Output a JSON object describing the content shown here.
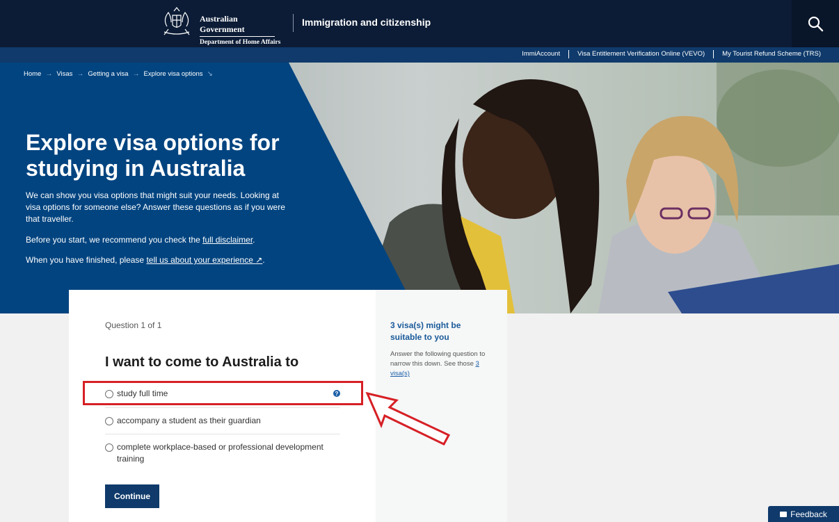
{
  "header": {
    "gov_line1": "Australian Government",
    "gov_line2": "Department of Home Affairs",
    "site_title": "Immigration and citizenship",
    "search_icon": "search-icon"
  },
  "utility_links": [
    "ImmiAccount",
    "Visa Entitlement Verification Online (VEVO)",
    "My Tourist Refund Scheme (TRS)"
  ],
  "breadcrumb": [
    "Home",
    "Visas",
    "Getting a visa",
    "Explore visa options"
  ],
  "hero": {
    "title": "Explore visa options for studying in Australia",
    "p1": "We can show you visa options that might suit your needs. Looking at visa options for someone else? Answer these questions as if you were that traveller.",
    "p2_before": "Before you start, we recommend you check the ",
    "p2_link": "full disclaimer",
    "p2_after": ".",
    "p3_before": "When you have finished, please ",
    "p3_link": "tell us about your experience",
    "p3_after": "."
  },
  "question": {
    "counter": "Question 1 of 1",
    "title": "I want to come to Australia to",
    "options": [
      "study full time",
      "accompany a student as their guardian",
      "complete workplace-based or professional development training"
    ],
    "continue_label": "Continue"
  },
  "sidebar": {
    "heading": "3 visa(s) might be suitable to you",
    "text_before": "Answer the following question to narrow this down. See those ",
    "text_link": "3 visa(s)"
  },
  "feedback_label": "Feedback",
  "colors": {
    "header_bg": "#0c1c36",
    "hero_blue": "#024480",
    "button": "#0f3a6b",
    "annotation": "#d62025"
  }
}
